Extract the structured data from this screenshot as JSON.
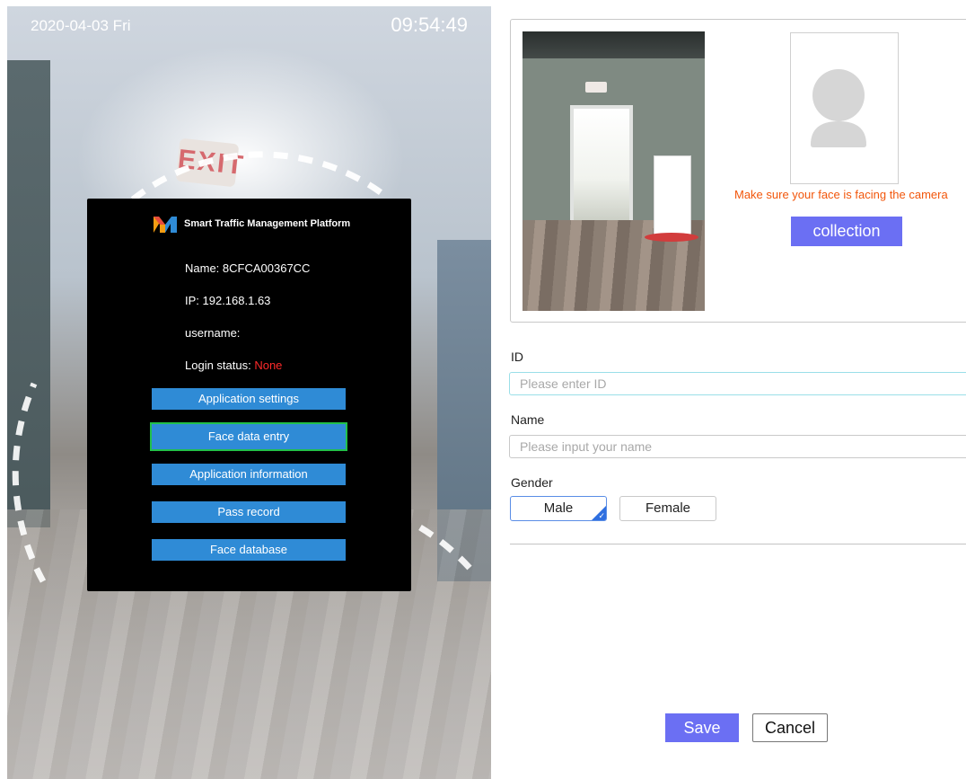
{
  "camera_screen": {
    "date": "2020-04-03 Fri",
    "time": "09:54:49",
    "exit_sign": "EXIT"
  },
  "login_dialog": {
    "title": "Smart Traffic Management Platform",
    "name_line": "Name: 8CFCA00367CC",
    "ip_line": "IP: 192.168.1.63",
    "username_line": "username:",
    "login_status_label": "Login status: ",
    "login_status_value": "None",
    "menu": [
      {
        "label": "Application settings",
        "selected": false
      },
      {
        "label": "Face data entry",
        "selected": true
      },
      {
        "label": "Application information",
        "selected": false
      },
      {
        "label": "Pass record",
        "selected": false
      },
      {
        "label": "Face database",
        "selected": false
      }
    ]
  },
  "face_entry": {
    "guide_text": "Make sure your face is facing the camera",
    "collection_label": "collection",
    "id_label": "ID",
    "id_placeholder": "Please enter ID",
    "name_label": "Name",
    "name_placeholder": "Please input your name",
    "gender_label": "Gender",
    "gender_options": [
      "Male",
      "Female"
    ],
    "gender_selected": "Male",
    "save_label": "Save",
    "cancel_label": "Cancel"
  },
  "colors": {
    "accent": "#6b6ff3",
    "menu_button": "#2f8bd6",
    "selected_outline": "#22c04a",
    "status_none": "#ff2a2a",
    "guide_text": "#f2560b"
  },
  "icons": [
    "brand-m-logo-icon",
    "avatar-placeholder-icon",
    "check-corner-icon"
  ]
}
